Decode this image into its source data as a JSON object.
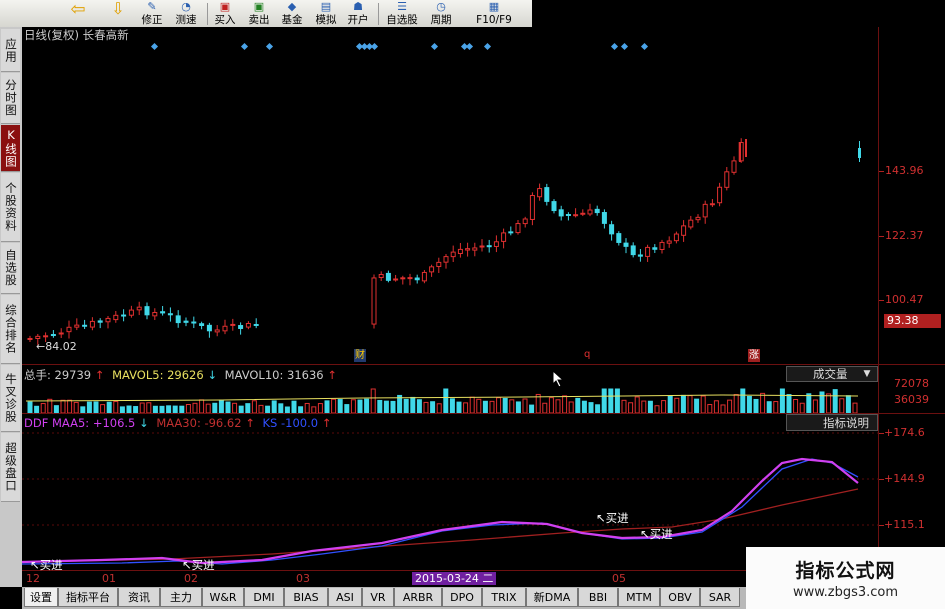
{
  "toolbar": {
    "buttons": [
      {
        "label": "",
        "icon": "back-arrow-icon"
      },
      {
        "label": "",
        "icon": "down-arrow-icon"
      },
      {
        "label": "修正",
        "icon": "edit-icon"
      },
      {
        "label": "测速",
        "icon": "speed-icon"
      },
      {
        "label": "买入",
        "icon": "buy-icon"
      },
      {
        "label": "卖出",
        "icon": "sell-icon"
      },
      {
        "label": "基金",
        "icon": "fund-icon"
      },
      {
        "label": "模拟",
        "icon": "simulate-icon"
      },
      {
        "label": "开户",
        "icon": "open-account-icon"
      },
      {
        "label": "自选股",
        "icon": "watchlist-icon"
      },
      {
        "label": "周期",
        "icon": "period-icon"
      },
      {
        "label": "F10/F9",
        "icon": "f10-icon"
      }
    ]
  },
  "sidebar": {
    "tabs": [
      "应用",
      "分时图",
      "K线图",
      "个股资料",
      "自选股",
      "综合排名",
      "牛叉诊股",
      "超级盘口"
    ]
  },
  "main_chart": {
    "header": "日线(复权)  长春高新",
    "price_axis": [
      "143.96",
      "122.37",
      "100.47"
    ],
    "current_price": "93.38",
    "low_label": "84.02",
    "event_markers": [
      "财",
      "q",
      "涨"
    ]
  },
  "volume_panel": {
    "total_hands": {
      "label": "总手:",
      "value": "29739"
    },
    "mavol5": {
      "label": "MAVOL5:",
      "value": "29626"
    },
    "mavol10": {
      "label": "MAVOL10:",
      "value": "31636"
    },
    "selector_label": "成交量",
    "axis": [
      "72078",
      "36039"
    ]
  },
  "ddf_panel": {
    "name": "DDF",
    "maa5": {
      "label": "MAA5:",
      "value": "+106.5"
    },
    "maa30": {
      "label": "MAA30:",
      "value": "-96.62"
    },
    "ks": {
      "label": "KS",
      "value": "-100.0"
    },
    "help_label": "指标说明",
    "axis": [
      "+174.6",
      "+144.9",
      "+115.1"
    ],
    "signals": [
      "买进",
      "买进",
      "买进",
      "买进"
    ]
  },
  "time_axis": {
    "labels": [
      "12",
      "01",
      "02",
      "03",
      "05"
    ],
    "cursor_date": "2015-03-24 二"
  },
  "bottom_tabs": [
    "设置",
    "指标平台",
    "资讯",
    "主力",
    "W&R",
    "DMI",
    "BIAS",
    "ASI",
    "VR",
    "ARBR",
    "DPO",
    "TRIX",
    "新DMA",
    "BBI",
    "MTM",
    "OBV",
    "SAR"
  ],
  "watermark": {
    "title": "指标公式网",
    "url": "www.zbgs3.com"
  },
  "colors": {
    "up": "#e03030",
    "down": "#40d8e8",
    "maa5": "#d040f0",
    "maa30": "#a02020",
    "ks": "#3050ff",
    "grid": "#6b1010"
  }
}
